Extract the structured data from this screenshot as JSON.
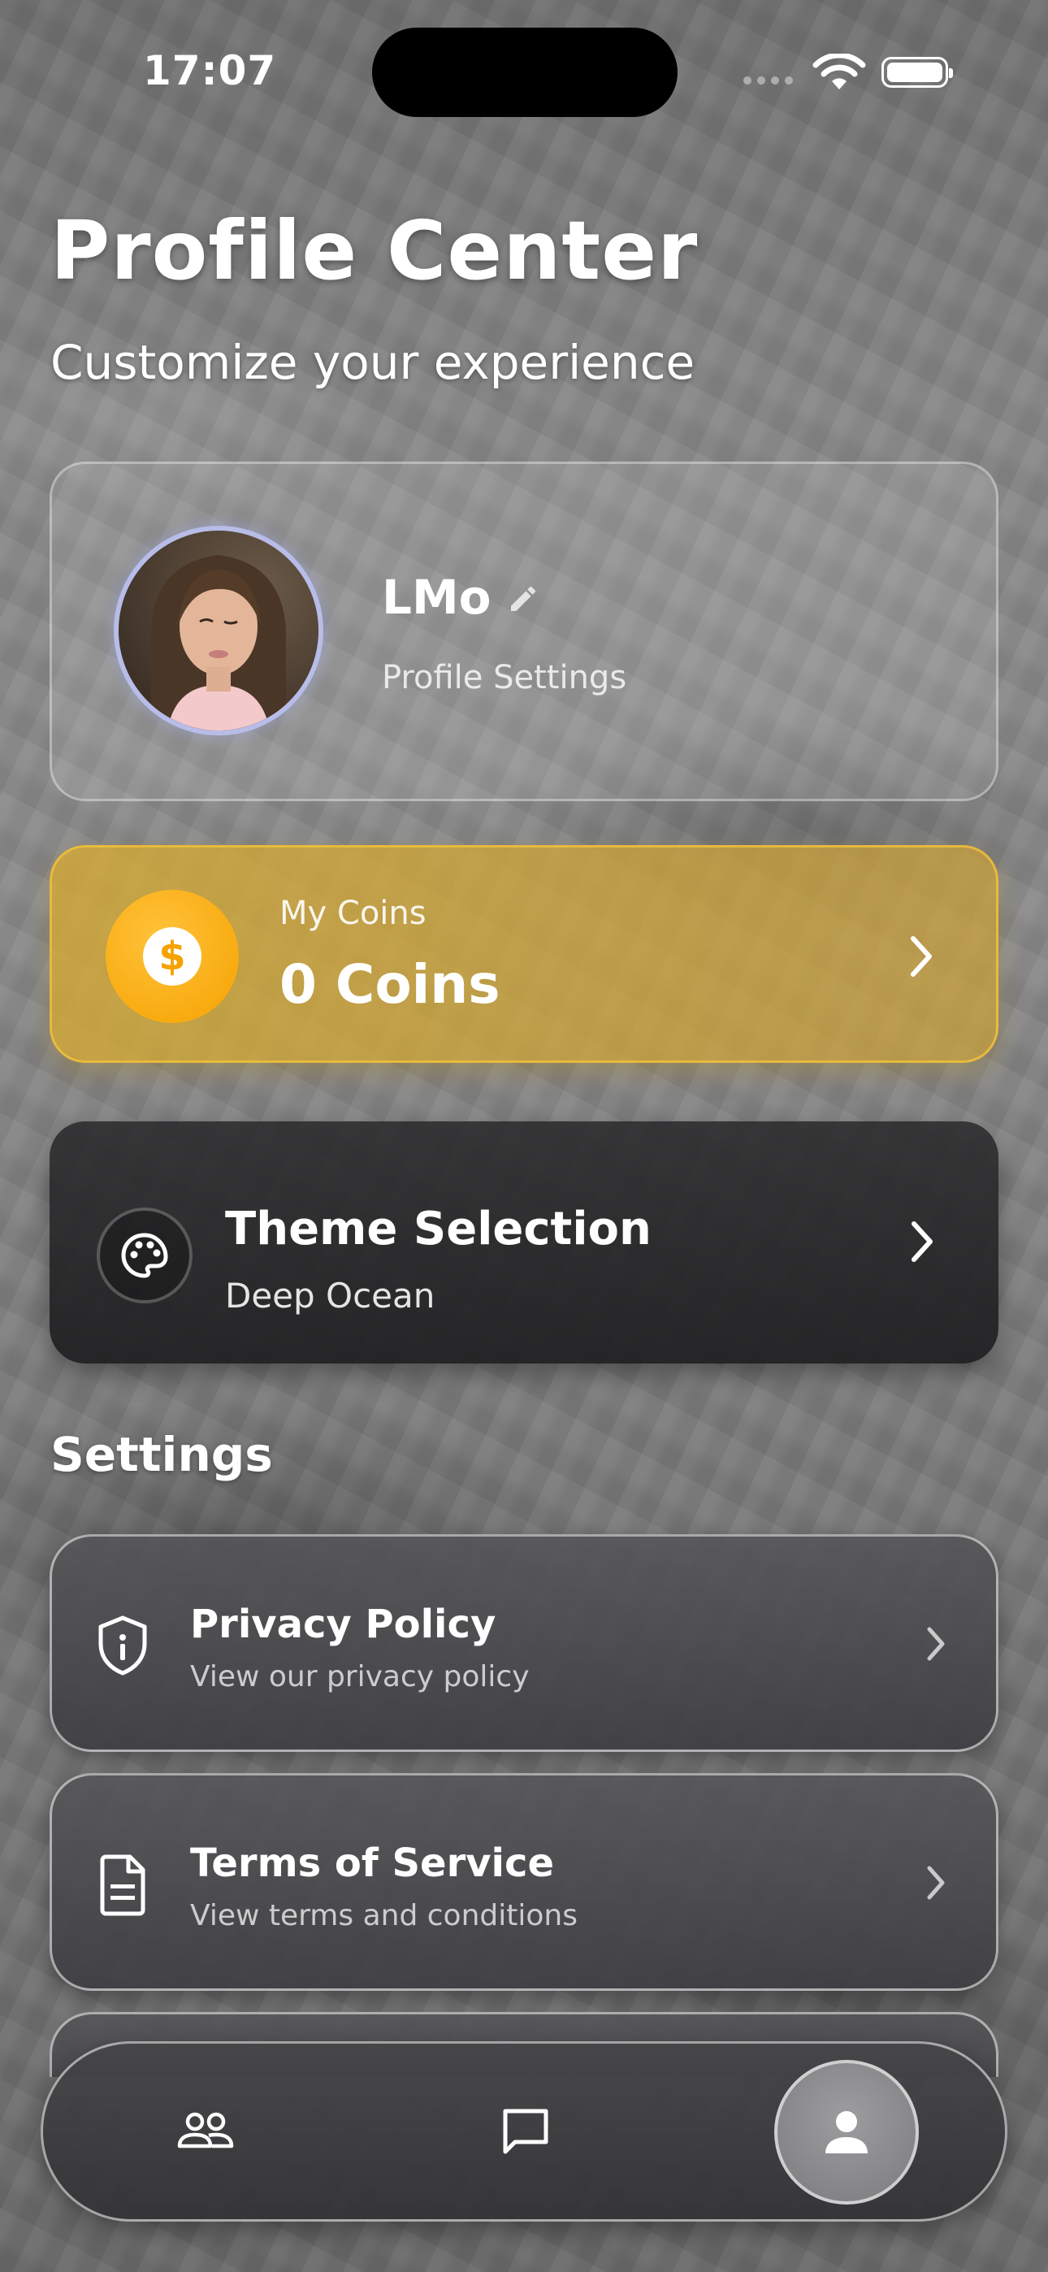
{
  "status_bar": {
    "time": "17:07"
  },
  "header": {
    "title": "Profile Center",
    "subtitle": "Customize your experience"
  },
  "profile": {
    "name": "LMo",
    "settings_label": "Profile Settings"
  },
  "coins": {
    "label": "My Coins",
    "value": "0 Coins",
    "symbol": "$"
  },
  "theme": {
    "title": "Theme Selection",
    "current": "Deep Ocean"
  },
  "settings": {
    "section_title": "Settings",
    "items": [
      {
        "title": "Privacy Policy",
        "subtitle": "View our privacy policy",
        "icon": "shield-info-icon"
      },
      {
        "title": "Terms of Service",
        "subtitle": "View terms and conditions",
        "icon": "document-icon"
      }
    ]
  },
  "tab_bar": {
    "tabs": [
      {
        "icon": "people-icon",
        "active": false
      },
      {
        "icon": "chat-icon",
        "active": false
      },
      {
        "icon": "person-icon",
        "active": true
      }
    ]
  },
  "colors": {
    "accent_gold": "#f5a200",
    "avatar_ring": "#b8bce8",
    "theme_card": "#2a2a2c"
  }
}
